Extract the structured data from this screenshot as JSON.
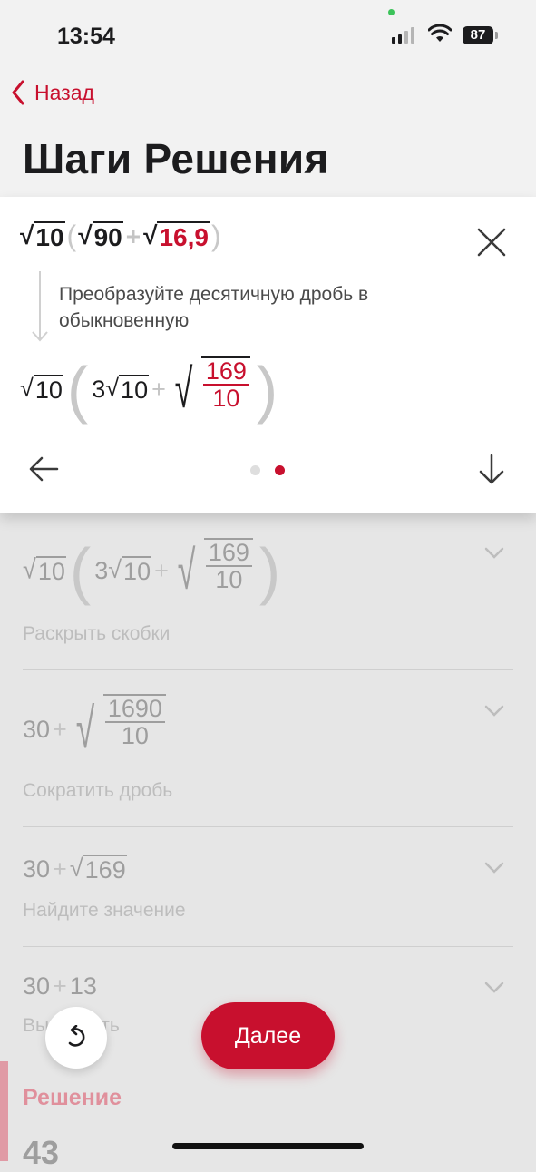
{
  "status": {
    "time": "13:54",
    "battery": "87"
  },
  "nav": {
    "back_label": "Назад",
    "title": "Шаги Решения"
  },
  "card": {
    "original": {
      "a": "10",
      "b": "90",
      "plus": "+",
      "c": "16,9"
    },
    "hint": "Преобразуйте десятичную дробь в обыкновенную",
    "result": {
      "a": "10",
      "coef": "3",
      "b": "10",
      "plus": "+",
      "num": "169",
      "den": "10"
    },
    "pager": {
      "total": 2,
      "active": 2
    }
  },
  "steps": [
    {
      "caption": "Раскрыть скобки",
      "a": "10",
      "coef": "3",
      "b": "10",
      "plus": "+",
      "num": "169",
      "den": "10"
    },
    {
      "caption": "Сократить дробь",
      "lead": "30",
      "plus": "+",
      "num": "1690",
      "den": "10"
    },
    {
      "caption": "Найдите значение",
      "lead": "30",
      "plus": "+",
      "rad": "169"
    },
    {
      "caption": "Вычислить",
      "lead": "30",
      "plus": "+",
      "val": "13"
    }
  ],
  "solution": {
    "label": "Решение",
    "value": "43"
  },
  "actions": {
    "next_label": "Далее"
  },
  "colors": {
    "accent": "#c8102e",
    "bg": "#e6e6e6",
    "card": "#ffffff"
  }
}
